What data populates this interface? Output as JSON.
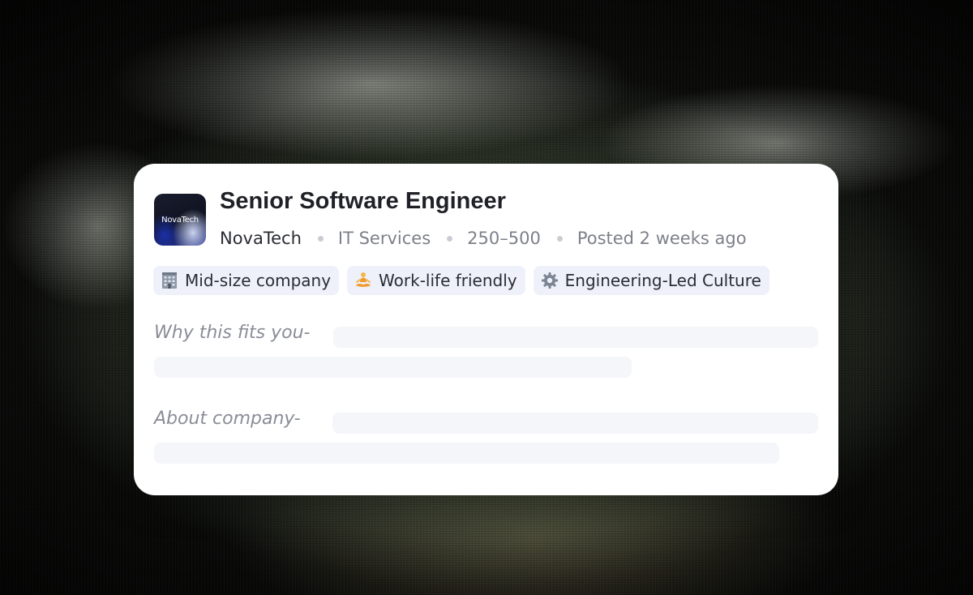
{
  "job": {
    "title": "Senior Software Engineer",
    "logo_text": "NovaTech",
    "company": "NovaTech",
    "industry": "IT Services",
    "size": "250–500",
    "posted": "Posted 2 weeks ago"
  },
  "tags": [
    {
      "icon": "office-building-icon",
      "label": "Mid-size company"
    },
    {
      "icon": "person-meditating-icon",
      "label": "Work-life friendly"
    },
    {
      "icon": "gear-icon",
      "label": "Engineering-Led Culture"
    }
  ],
  "sections": {
    "fit_label": "Why this fits you-",
    "about_label": "About company-"
  },
  "colors": {
    "card_bg": "#ffffff",
    "tag_bg": "#eef0fa",
    "skeleton": "#f5f6fa",
    "title": "#1f2126",
    "muted": "#7d8089"
  }
}
